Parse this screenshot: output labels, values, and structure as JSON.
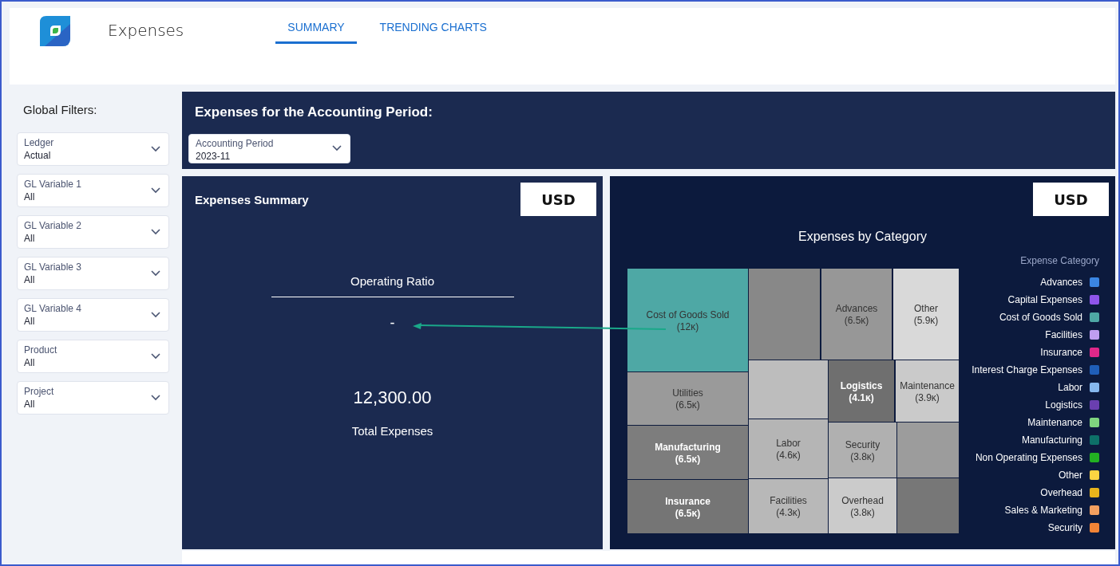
{
  "header": {
    "title": "Expenses",
    "tabs": [
      {
        "label": "SUMMARY",
        "selected": true
      },
      {
        "label": "TRENDING CHARTS",
        "selected": false
      }
    ]
  },
  "sidebar": {
    "title": "Global Filters:",
    "filters": [
      {
        "label": "Ledger",
        "value": "Actual"
      },
      {
        "label": "GL Variable 1",
        "value": "All"
      },
      {
        "label": "GL Variable 2",
        "value": "All"
      },
      {
        "label": "GL Variable 3",
        "value": "All"
      },
      {
        "label": "GL Variable 4",
        "value": "All"
      },
      {
        "label": "Product",
        "value": "All"
      },
      {
        "label": "Project",
        "value": "All"
      }
    ]
  },
  "period": {
    "title": "Expenses for the Accounting Period:",
    "dropdown": {
      "label": "Accounting Period",
      "value": "2023-11"
    }
  },
  "summary": {
    "title": "Expenses Summary",
    "currency": "USD",
    "ratio_label": "Operating Ratio",
    "ratio_value": "-",
    "total": "12,300.00",
    "total_label": "Total Expenses"
  },
  "category_chart": {
    "currency": "USD",
    "title": "Expenses by Category",
    "tiles": [
      {
        "label": "Cost of Goods Sold",
        "value": "(12ĸ)",
        "color": "#4ea8a5"
      },
      {
        "color": "#888888"
      },
      {
        "label": "Advances",
        "value": "(6.5ĸ)",
        "color": "#979797"
      },
      {
        "label": "Other",
        "value": "(5.9ĸ)",
        "color": "#d9d9d9"
      },
      {
        "label": "Utilities",
        "value": "(6.5ĸ)",
        "color": "#9a9a9a"
      },
      {
        "color": "#bdbdbd"
      },
      {
        "label": "Logistics",
        "value": "(4.1ĸ)",
        "color": "#6f6f6f"
      },
      {
        "label": "Maintenance",
        "value": "(3.9ĸ)",
        "color": "#cacaca"
      },
      {
        "label": "Manufacturing",
        "value": "(6.5ĸ)",
        "color": "#7d7d7d"
      },
      {
        "label": "Labor",
        "value": "(4.6ĸ)",
        "color": "#b5b5b5"
      },
      {
        "label": "Security",
        "value": "(3.8ĸ)",
        "color": "#b0b0b0"
      },
      {
        "color": "#9c9c9c"
      },
      {
        "label": "Insurance",
        "value": "(6.5ĸ)",
        "color": "#757575"
      },
      {
        "label": "Facilities",
        "value": "(4.3ĸ)",
        "color": "#b8b8b8"
      },
      {
        "label": "Overhead",
        "value": "(3.8ĸ)",
        "color": "#cbcbcb"
      },
      {
        "color": "#777777"
      }
    ],
    "legend": {
      "title": "Expense Category",
      "items": [
        {
          "label": "Advances",
          "color": "#3b86e3"
        },
        {
          "label": "Capital Expenses",
          "color": "#8f55ea"
        },
        {
          "label": "Cost of Goods Sold",
          "color": "#4ea8a5"
        },
        {
          "label": "Facilities",
          "color": "#c09ef0"
        },
        {
          "label": "Insurance",
          "color": "#e0288a"
        },
        {
          "label": "Interest Charge Expenses",
          "color": "#1f5eb8"
        },
        {
          "label": "Labor",
          "color": "#86b8ee"
        },
        {
          "label": "Logistics",
          "color": "#6a3fb0"
        },
        {
          "label": "Maintenance",
          "color": "#7fd67f"
        },
        {
          "label": "Manufacturing",
          "color": "#0d7068"
        },
        {
          "label": "Non Operating Expenses",
          "color": "#22b022"
        },
        {
          "label": "Other",
          "color": "#fcd442"
        },
        {
          "label": "Overhead",
          "color": "#e8b41c"
        },
        {
          "label": "Sales & Marketing",
          "color": "#f4a060"
        },
        {
          "label": "Security",
          "color": "#f28436"
        }
      ]
    }
  }
}
